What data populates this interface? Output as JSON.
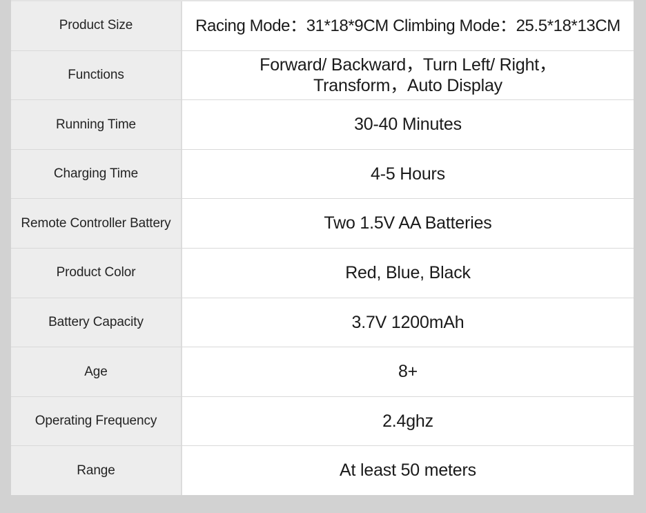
{
  "table": {
    "rows": [
      {
        "label": "Product Size",
        "value": "Racing Mode：31*18*9CM  Climbing Mode：25.5*18*13CM"
      },
      {
        "label": "Functions",
        "value": "Forward/ Backward，Turn Left/ Right，\nTransform，Auto Display"
      },
      {
        "label": "Running Time",
        "value": "30-40 Minutes"
      },
      {
        "label": "Charging Time",
        "value": "4-5 Hours"
      },
      {
        "label": "Remote Controller Battery",
        "value": "Two 1.5V AA Batteries"
      },
      {
        "label": "Product Color",
        "value": "Red, Blue, Black"
      },
      {
        "label": "Battery Capacity",
        "value": "3.7V  1200mAh"
      },
      {
        "label": "Age",
        "value": "8+"
      },
      {
        "label": "Operating Frequency",
        "value": "2.4ghz"
      },
      {
        "label": "Range",
        "value": "At least 50 meters"
      }
    ]
  },
  "colors": {
    "page_background": "#d2d2d2",
    "label_cell_background": "#ededed",
    "value_cell_background": "#ffffff",
    "row_divider": "#d9d9d9",
    "column_divider": "#dcdcdc",
    "label_text": "#232323",
    "value_text": "#1a1a1a"
  }
}
